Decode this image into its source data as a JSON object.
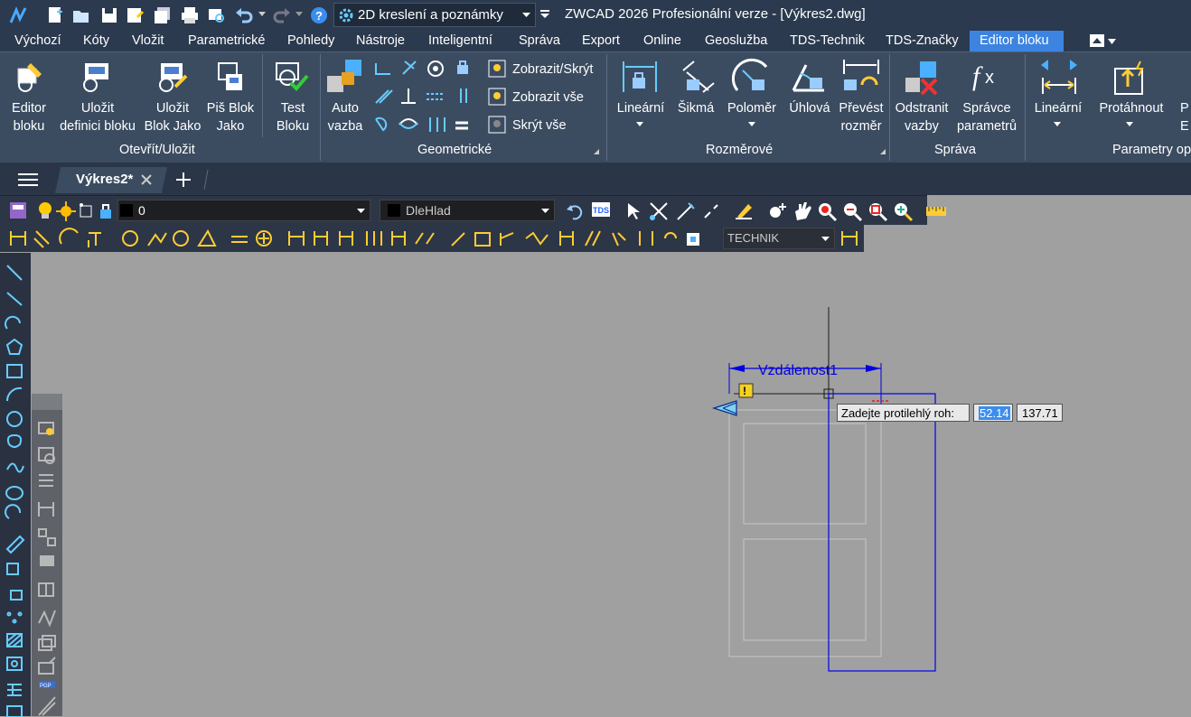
{
  "title_bar": {
    "workspace_label": "2D kreslení a poznámky",
    "title": "ZWCAD 2026 Profesionální verze - [Výkres2.dwg]"
  },
  "menu": [
    "Výchozí",
    "Kóty",
    "Vložit",
    "Parametrické",
    "Pohledy",
    "Nástroje",
    "Inteligentní",
    "Správa",
    "Export",
    "Online",
    "Geoslužba",
    "TDS-Technik",
    "TDS-Značky",
    "Editor bloku"
  ],
  "ribbon": {
    "buttons": [
      {
        "l1": "Editor",
        "l2": "bloku"
      },
      {
        "l1": "Uložit",
        "l2": "definici bloku"
      },
      {
        "l1": "Uložit",
        "l2": "Blok Jako"
      },
      {
        "l1": "Piš Blok",
        "l2": "Jako"
      },
      {
        "l1": "Test",
        "l2": "Bloku"
      },
      {
        "l1": "Auto",
        "l2": "vazba"
      },
      {
        "l1": "Lineární",
        "l2": ""
      },
      {
        "l1": "Šikmá",
        "l2": ""
      },
      {
        "l1": "Poloměr",
        "l2": ""
      },
      {
        "l1": "Úhlová",
        "l2": ""
      },
      {
        "l1": "Převést",
        "l2": "rozměr"
      },
      {
        "l1": "Odstranit",
        "l2": "vazby"
      },
      {
        "l1": "Správce",
        "l2": "parametrů"
      },
      {
        "l1": "Lineární",
        "l2": ""
      },
      {
        "l1": "Protáhnout",
        "l2": ""
      },
      {
        "l1": "P",
        "l2": "E"
      }
    ],
    "small": [
      "Zobrazit/Skrýt",
      "Zobrazit vše",
      "Skrýt vše"
    ],
    "panels": [
      "Otevřít/Uložit",
      "Geometrické",
      "Rozměrové",
      "Správa",
      "Parametry op"
    ]
  },
  "doc_tab": "Výkres2*",
  "layer": {
    "value": "0",
    "linetype": "DleHlad"
  },
  "dimstyle": "TECHNIK",
  "drawing": {
    "dim_label": "Vzdálenost1",
    "prompt": "Zadejte protilehlý roh:",
    "x_value": "52.14",
    "y_value": "137.71",
    "warn": "!"
  }
}
